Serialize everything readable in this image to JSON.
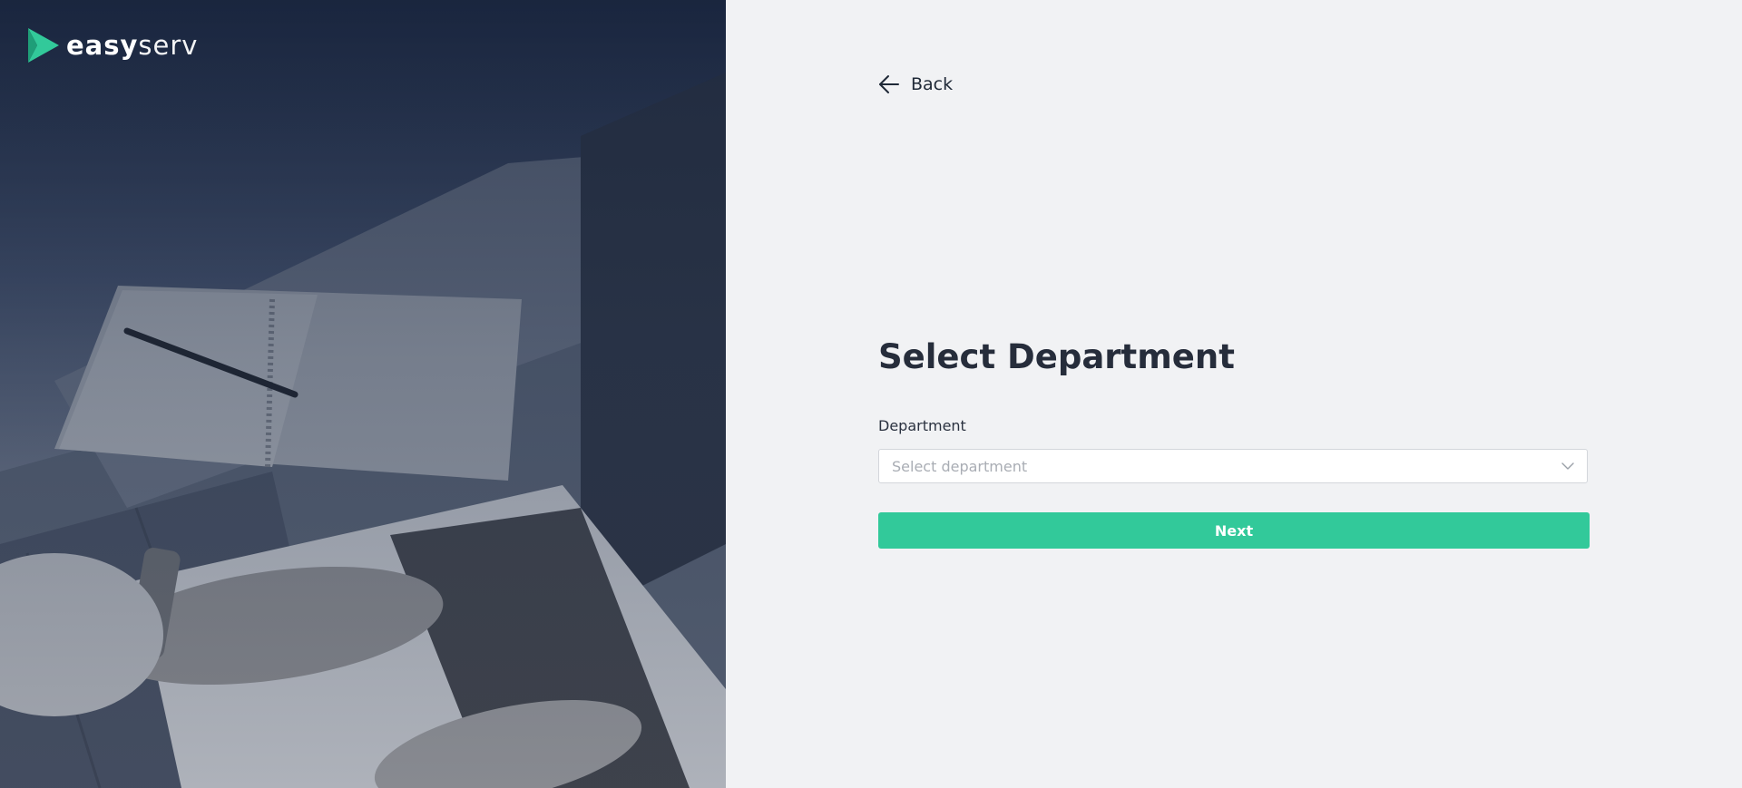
{
  "brand": {
    "logo_text_bold": "easy",
    "logo_text_light": "serv",
    "accent_color": "#32c99a"
  },
  "nav": {
    "back_label": "Back",
    "back_icon": "arrow-left-icon"
  },
  "form": {
    "title": "Select Department",
    "department_label": "Department",
    "department_placeholder": "Select department",
    "dropdown_icon": "chevron-down-icon",
    "submit_label": "Next"
  },
  "hero": {
    "image_description_icon": "laptop-workspace-photo"
  }
}
